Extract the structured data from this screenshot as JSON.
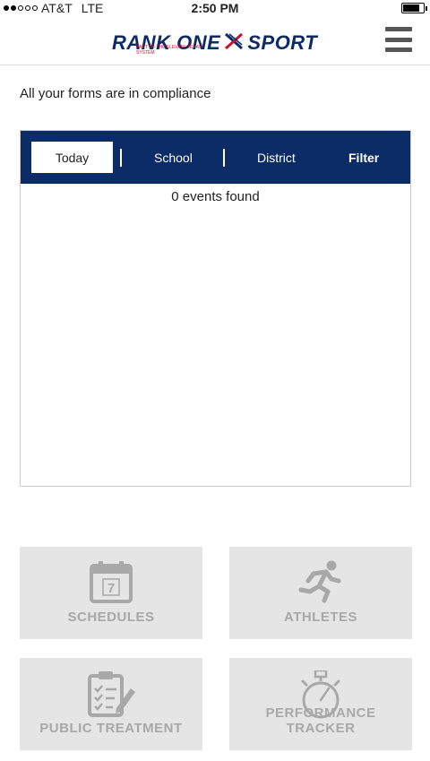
{
  "status_bar": {
    "carrier": "AT&T",
    "network": "LTE",
    "time": "2:50 PM"
  },
  "header": {
    "logo_text_left": "RANK ONE",
    "logo_text_right": "SPORT",
    "logo_tagline": "PART OF THE ELEVATE TEXAS SYSTEM"
  },
  "compliance_message": "All your forms are in compliance",
  "events": {
    "tabs": [
      "Today",
      "School",
      "District",
      "Filter"
    ],
    "selected_tab": "Today",
    "count_text": "0 events found"
  },
  "tiles": [
    {
      "label": "SCHEDULES",
      "icon": "calendar-icon",
      "calendar_day": "7"
    },
    {
      "label": "ATHLETES",
      "icon": "runner-icon"
    },
    {
      "label": "PUBLIC TREATMENT",
      "icon": "clipboard-icon"
    },
    {
      "label": "PERFORMANCE TRACKER",
      "icon": "stopwatch-icon"
    }
  ],
  "colors": {
    "brand_navy": "#0b2c66",
    "brand_red": "#c8102e",
    "tile_bg": "#e5e5e5",
    "tile_fg": "#a8a8a8"
  }
}
